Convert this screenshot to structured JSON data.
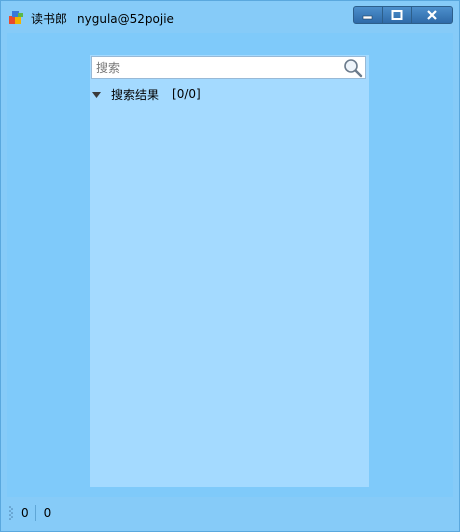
{
  "window": {
    "app_name": "读书郎",
    "user": "nygula@52pojie"
  },
  "search": {
    "placeholder": "搜索",
    "value": ""
  },
  "results": {
    "label": "搜索结果",
    "count": "[0/0]",
    "expanded": true
  },
  "status": {
    "left_value": "0",
    "right_value": "0"
  },
  "colors": {
    "window_bg": "#86cbf8",
    "panel_bg": "#a4daff",
    "title_button": "#2e6aa8"
  }
}
